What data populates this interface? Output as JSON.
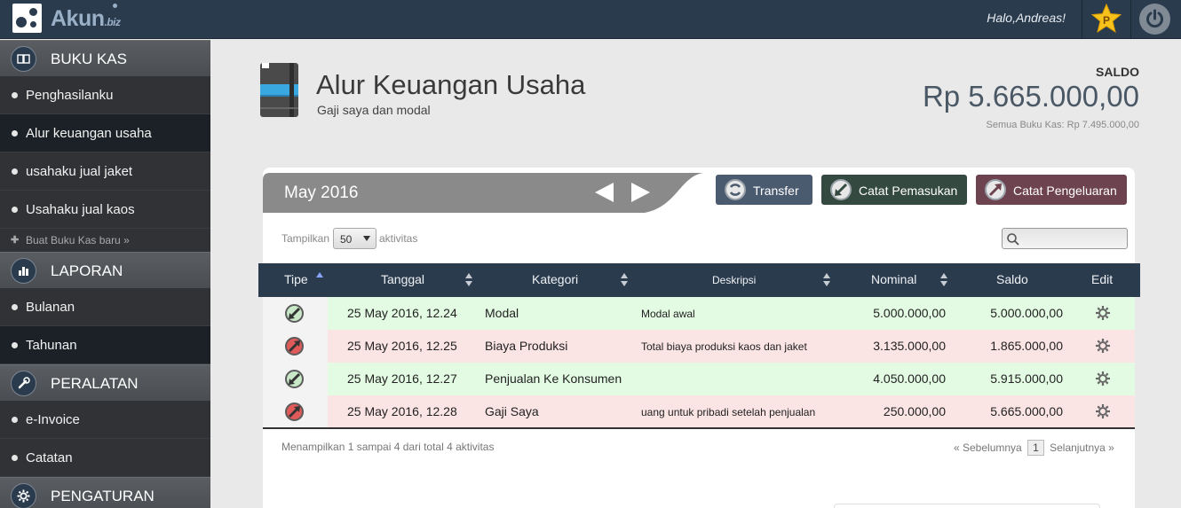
{
  "topbar": {
    "brand": "Akun",
    "brand_suffix": "biz",
    "greeting": "Halo,Andreas!",
    "premium_letter": "P"
  },
  "sidebar": {
    "sections": [
      {
        "title": "BUKU KAS",
        "icon": "book-icon"
      },
      {
        "title": "LAPORAN",
        "icon": "bar-chart-icon"
      },
      {
        "title": "PERALATAN",
        "icon": "wrench-icon"
      },
      {
        "title": "PENGATURAN",
        "icon": "gear-icon"
      }
    ],
    "buku_kas_items": [
      "Penghasilanku",
      "Alur keuangan usaha",
      "usahaku jual jaket",
      "Usahaku jual kaos"
    ],
    "new_book": "Buat Buku Kas baru »",
    "laporan_items": [
      "Bulanan",
      "Tahunan"
    ],
    "peralatan_items": [
      "e-Invoice",
      "Catatan"
    ]
  },
  "page": {
    "title": "Alur Keuangan Usaha",
    "subtitle": "Gaji saya dan modal",
    "saldo_label": "SALDO",
    "saldo_value": "Rp 5.665.000,00",
    "saldo_all": "Semua Buku Kas: Rp 7.495.000,00"
  },
  "toolbar": {
    "month": "May 2016",
    "transfer": "Transfer",
    "income": "Catat Pemasukan",
    "expense": "Catat Pengeluaran",
    "show_label": "Tampilkan",
    "show_value": "50",
    "show_suffix": "aktivitas",
    "search_placeholder": ""
  },
  "colors": {
    "navy": "#2b3b4e",
    "income_row": "#e3fbe3",
    "expense_row": "#fbe4e4",
    "transfer_btn": "#4a5b70",
    "income_btn": "#34493f",
    "expense_btn": "#6d434f"
  },
  "table": {
    "headers": [
      "Tipe",
      "Tanggal",
      "Kategori",
      "Deskripsi",
      "Nominal",
      "Saldo",
      "Edit"
    ],
    "rows": [
      {
        "type": "in",
        "date": "25 May 2016, 12.24",
        "category": "Modal",
        "desc": "Modal awal",
        "nominal": "5.000.000,00",
        "saldo": "5.000.000,00"
      },
      {
        "type": "out",
        "date": "25 May 2016, 12.25",
        "category": "Biaya Produksi",
        "desc": "Total biaya produksi kaos dan jaket",
        "nominal": "3.135.000,00",
        "saldo": "1.865.000,00"
      },
      {
        "type": "in",
        "date": "25 May 2016, 12.27",
        "category": "Penjualan Ke Konsumen",
        "desc": "",
        "nominal": "4.050.000,00",
        "saldo": "5.915.000,00"
      },
      {
        "type": "out",
        "date": "25 May 2016, 12.28",
        "category": "Gaji Saya",
        "desc": "uang untuk pribadi setelah penjualan",
        "nominal": "250.000,00",
        "saldo": "5.665.000,00"
      }
    ],
    "footer_info": "Menampilkan 1 sampai 4 dari total 4 aktivitas",
    "prev": "« Sebelumnya",
    "page": "1",
    "next": "Selanjutnya »"
  }
}
